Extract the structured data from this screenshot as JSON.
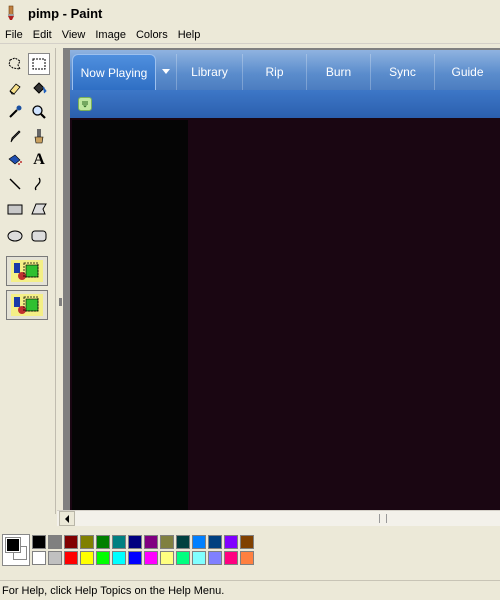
{
  "window": {
    "title": "pimp - Paint",
    "icon": "paint-brush-icon"
  },
  "menubar": {
    "items": [
      "File",
      "Edit",
      "View",
      "Image",
      "Colors",
      "Help"
    ]
  },
  "toolbox": {
    "tools": [
      {
        "name": "free-form-select-icon"
      },
      {
        "name": "rect-select-icon",
        "selected": true
      },
      {
        "name": "eraser-icon"
      },
      {
        "name": "fill-bucket-icon"
      },
      {
        "name": "color-picker-icon"
      },
      {
        "name": "magnifier-icon"
      },
      {
        "name": "pencil-icon"
      },
      {
        "name": "brush-icon"
      },
      {
        "name": "airbrush-icon"
      },
      {
        "name": "text-icon",
        "glyph": "A"
      },
      {
        "name": "line-icon"
      },
      {
        "name": "curve-icon"
      },
      {
        "name": "rectangle-icon"
      },
      {
        "name": "polygon-icon"
      },
      {
        "name": "ellipse-icon"
      },
      {
        "name": "rounded-rect-icon"
      }
    ]
  },
  "canvas": {
    "wmp": {
      "tabs": [
        "Now Playing",
        "Library",
        "Rip",
        "Burn",
        "Sync",
        "Guide"
      ],
      "active_tab": "Now Playing"
    }
  },
  "palette": {
    "foreground": "#000000",
    "background": "#ffffff",
    "top_row": [
      "#000000",
      "#808080",
      "#800000",
      "#808000",
      "#008000",
      "#008080",
      "#000080",
      "#800080",
      "#808040",
      "#004040",
      "#0080ff",
      "#004080",
      "#8000ff",
      "#804000"
    ],
    "bottom_row": [
      "#ffffff",
      "#c0c0c0",
      "#ff0000",
      "#ffff00",
      "#00ff00",
      "#00ffff",
      "#0000ff",
      "#ff00ff",
      "#ffff80",
      "#00ff80",
      "#80ffff",
      "#8080ff",
      "#ff0080",
      "#ff8040"
    ]
  },
  "status": {
    "text": "For Help, click Help Topics on the Help Menu."
  }
}
